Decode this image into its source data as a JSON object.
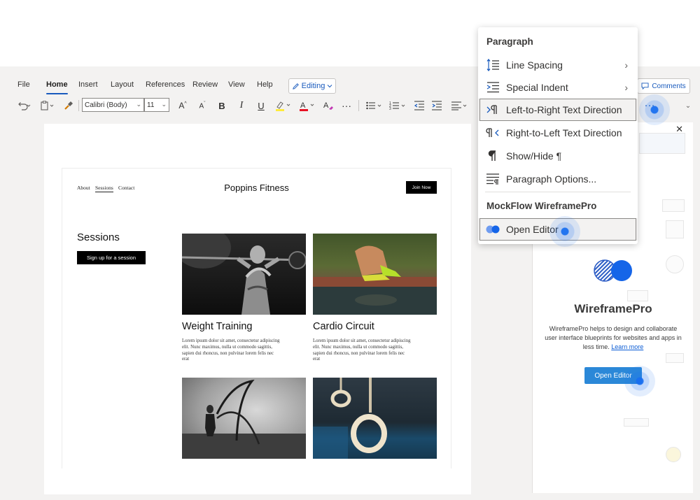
{
  "ribbon": {
    "tabs": [
      "File",
      "Home",
      "Insert",
      "Layout",
      "References",
      "Review",
      "View",
      "Help"
    ],
    "editing_label": "Editing",
    "comments_label": "Comments",
    "font_name": "Calibri (Body)",
    "font_size": "11",
    "more_label": "···"
  },
  "site": {
    "nav": [
      "About",
      "Sessions",
      "Contact"
    ],
    "brand": "Poppins Fitness",
    "join_label": "Join Now",
    "heading": "Sessions",
    "signup_label": "Sign up for a session",
    "cards": [
      {
        "title": "Weight Training",
        "desc": "Lorem ipsum dolor sit amet, consectetur adipiscing elit. Nunc maximus, nulla ut commodo sagittis, sapien dui rhoncus, non pulvinar lorem felis nec erat"
      },
      {
        "title": "Cardio Circuit",
        "desc": "Lorem ipsum dolor sit amet, consectetur adipiscing elit. Nunc maximus, nulla ut commodo sagittis, sapien dui rhoncus, non pulvinar lorem felis nec erat"
      }
    ]
  },
  "menu": {
    "paragraph_heading": "Paragraph",
    "items": [
      {
        "label": "Line Spacing",
        "icon": "line-spacing-icon"
      },
      {
        "label": "Special Indent",
        "icon": "special-indent-icon"
      },
      {
        "label": "Left-to-Right Text Direction",
        "icon": "ltr-direction-icon"
      },
      {
        "label": "Right-to-Left Text Direction",
        "icon": "rtl-direction-icon"
      },
      {
        "label": "Show/Hide ¶",
        "icon": "pilcrow-icon"
      },
      {
        "label": "Paragraph Options...",
        "icon": "paragraph-options-icon"
      }
    ],
    "addin_heading": "MockFlow WireframePro",
    "addin_item": "Open Editor"
  },
  "pane": {
    "title": "WireframePro",
    "desc": "WireframePro helps to design and collaborate user interface blueprints for websites and apps in less time.",
    "learn_more": "Learn more",
    "open_label": "Open Editor"
  },
  "colors": {
    "accent": "#185abd",
    "highlight": "#ffeb3b",
    "font_color": "#e81123",
    "tap": "#186ef0"
  }
}
